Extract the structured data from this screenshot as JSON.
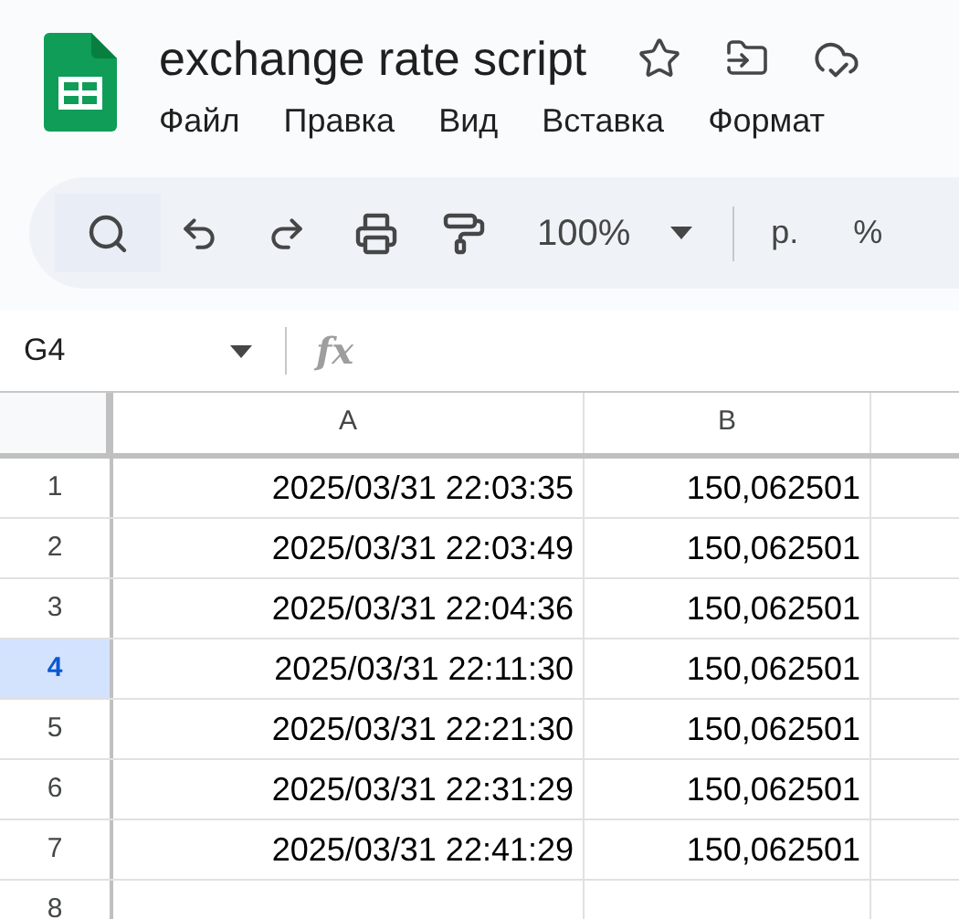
{
  "document": {
    "title": "exchange rate script"
  },
  "menu": [
    "Файл",
    "Правка",
    "Вид",
    "Вставка",
    "Формат"
  ],
  "toolbar": {
    "zoom": "100%",
    "currency": "р.",
    "percent": "%"
  },
  "formula_bar": {
    "cell_reference": "G4",
    "function_label": "fx"
  },
  "sheet": {
    "columns": [
      "A",
      "B"
    ],
    "rows": [
      {
        "number": "1",
        "selected": false,
        "cells": [
          "2025/03/31 22:03:35",
          "150,062501"
        ]
      },
      {
        "number": "2",
        "selected": false,
        "cells": [
          "2025/03/31 22:03:49",
          "150,062501"
        ]
      },
      {
        "number": "3",
        "selected": false,
        "cells": [
          "2025/03/31 22:04:36",
          "150,062501"
        ]
      },
      {
        "number": "4",
        "selected": true,
        "cells": [
          "2025/03/31 22:11:30",
          "150,062501"
        ]
      },
      {
        "number": "5",
        "selected": false,
        "cells": [
          "2025/03/31 22:21:30",
          "150,062501"
        ]
      },
      {
        "number": "6",
        "selected": false,
        "cells": [
          "2025/03/31 22:31:29",
          "150,062501"
        ]
      },
      {
        "number": "7",
        "selected": false,
        "cells": [
          "2025/03/31 22:41:29",
          "150,062501"
        ]
      },
      {
        "number": "8",
        "selected": false,
        "cells": [
          "",
          ""
        ]
      }
    ]
  }
}
